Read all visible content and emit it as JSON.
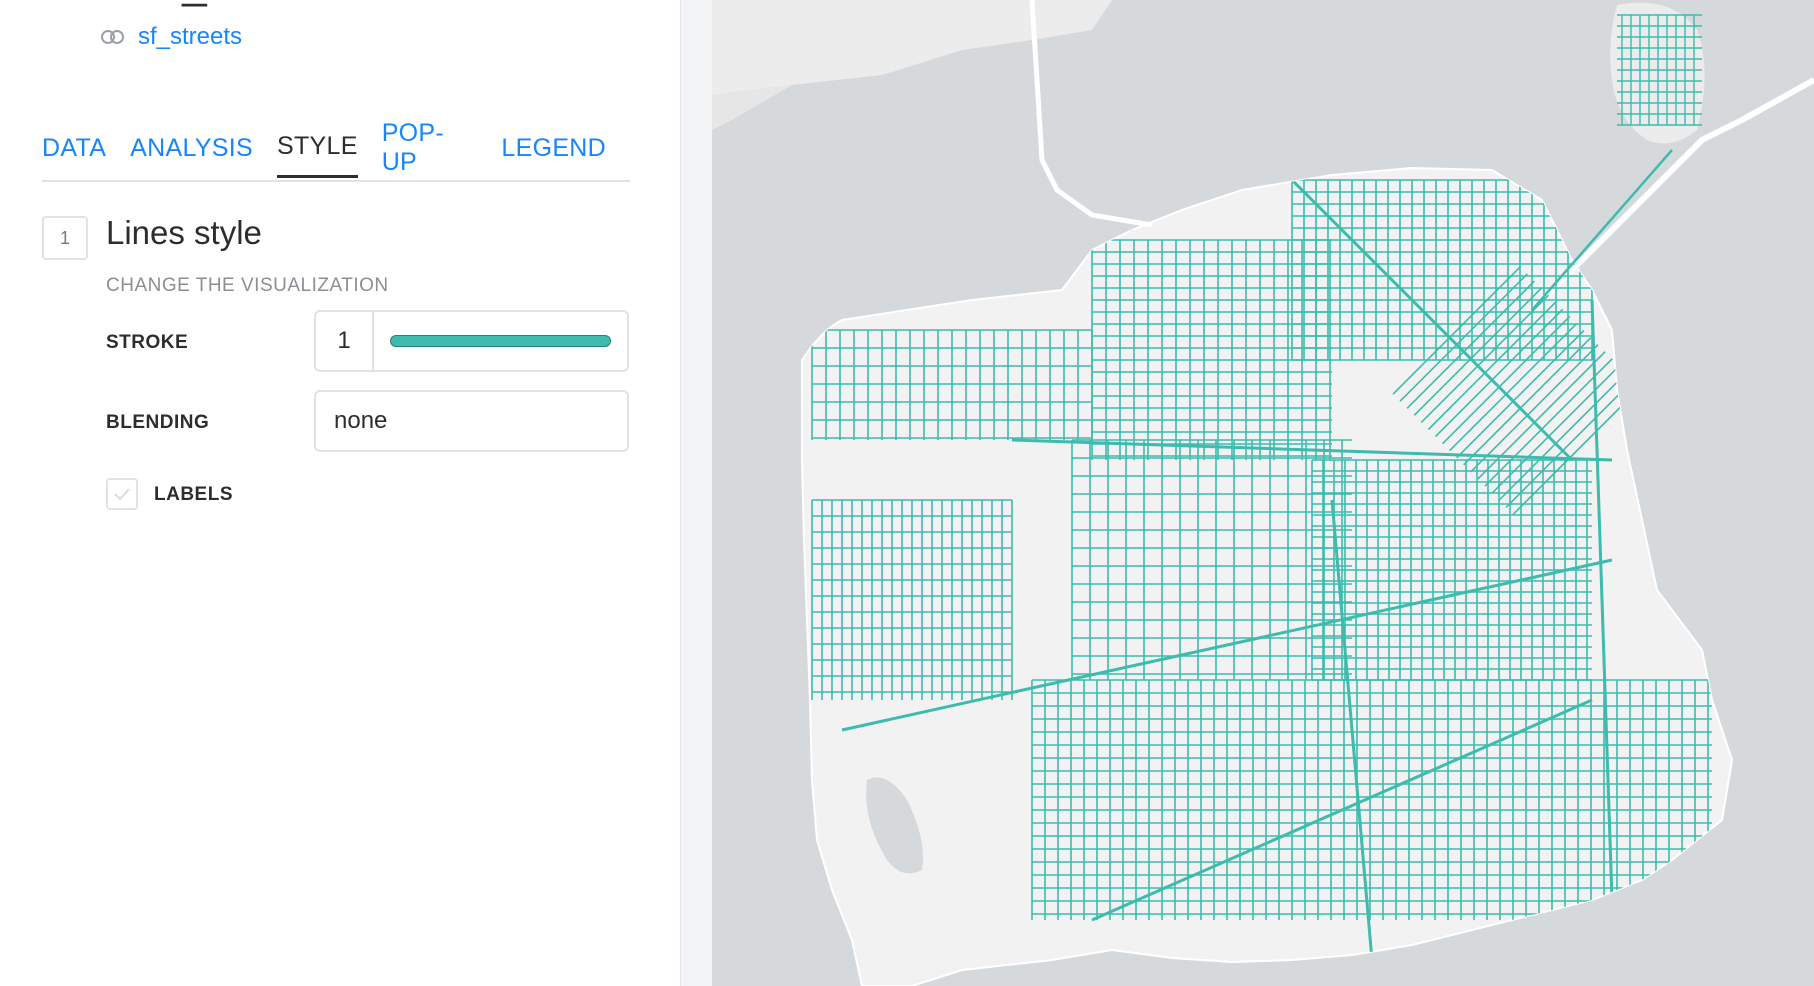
{
  "layer": {
    "title": "sf_streets",
    "source_name": "sf_streets",
    "swatch_color": "#e8587d"
  },
  "tabs": [
    {
      "label": "DATA",
      "active": false
    },
    {
      "label": "ANALYSIS",
      "active": false
    },
    {
      "label": "STYLE",
      "active": true
    },
    {
      "label": "POP-UP",
      "active": false
    },
    {
      "label": "LEGEND",
      "active": false
    }
  ],
  "style_section": {
    "step_number": "1",
    "title": "Lines style",
    "subtitle": "CHANGE THE VISUALIZATION",
    "stroke_label": "STROKE",
    "stroke_value": "1",
    "stroke_color": "#3dbbac",
    "blending_label": "BLENDING",
    "blending_value": "none",
    "labels_label": "LABELS",
    "labels_checked": false
  },
  "colors": {
    "accent": "#1785fb",
    "street_line": "#3dbbac",
    "map_water": "#d6d9dc",
    "map_land": "#f2f2f2"
  },
  "map": {
    "icon_names": [
      "sf-street-network-map"
    ]
  }
}
